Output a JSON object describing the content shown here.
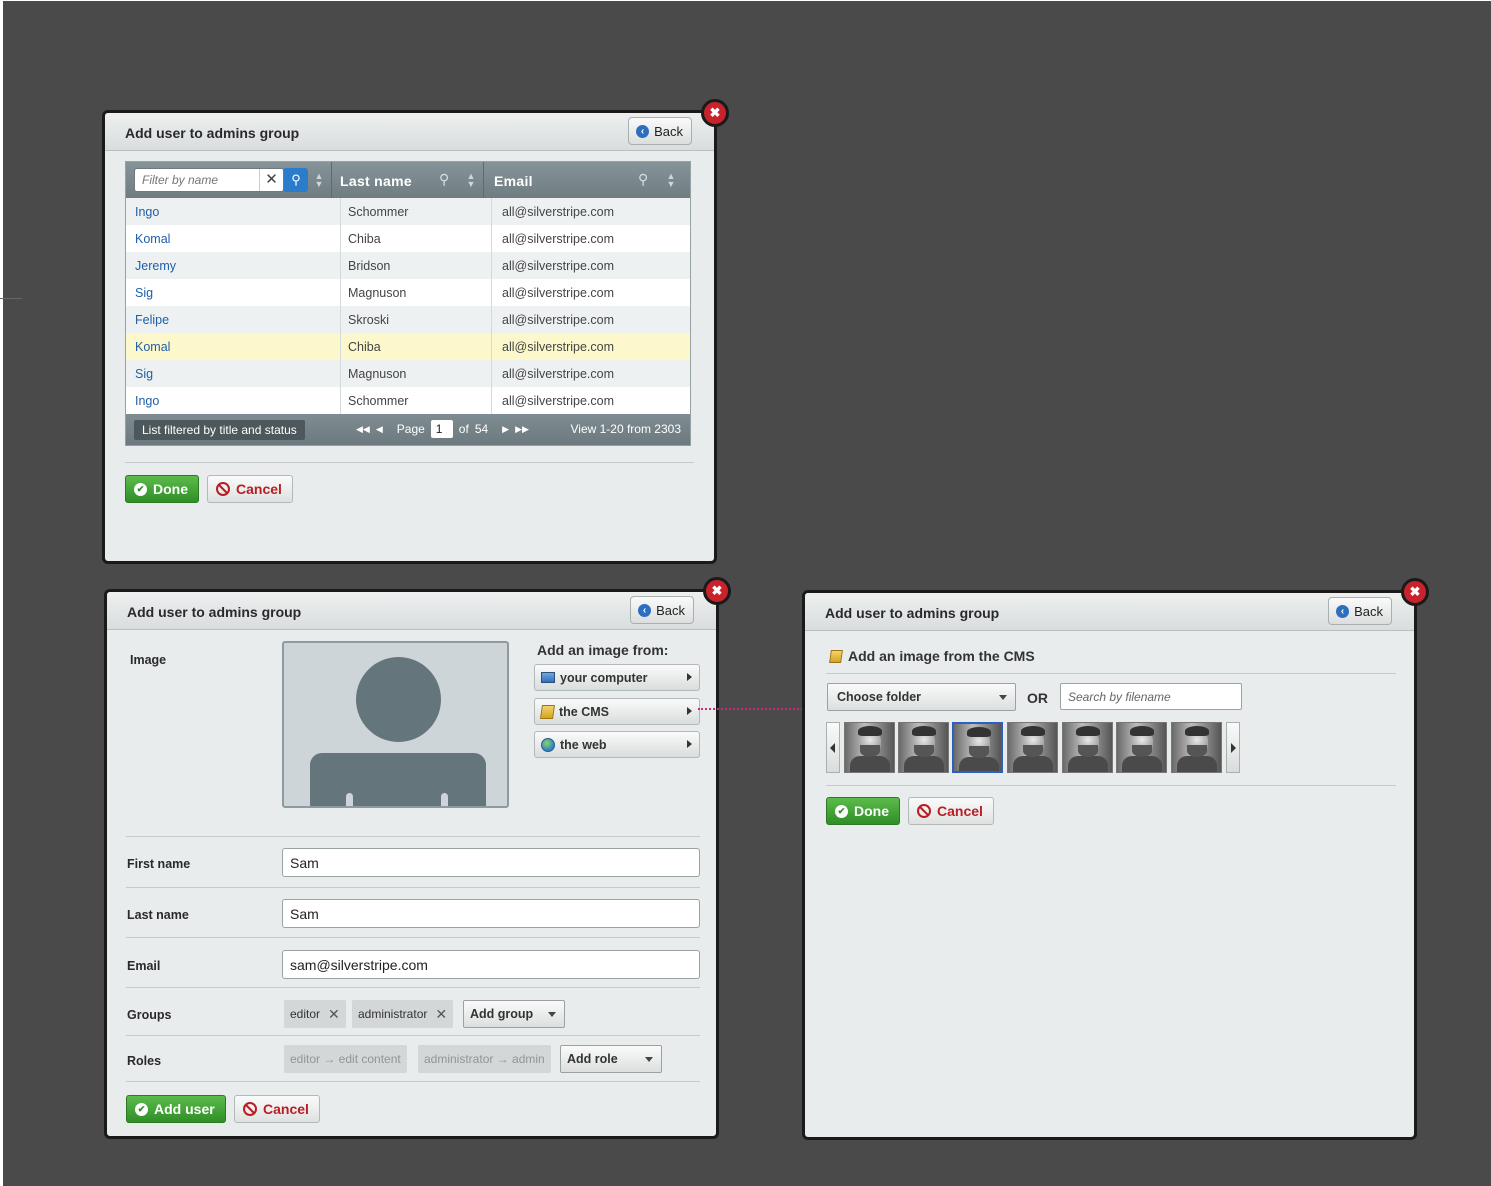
{
  "dialog1": {
    "title": "Add user to admins group",
    "back_label": "Back",
    "close_label": "✖",
    "filter_placeholder": "Filter by name",
    "columns": [
      "Last name",
      "Email"
    ],
    "rows": [
      {
        "first": "Ingo",
        "last": "Schommer",
        "email": "all@silverstripe.com"
      },
      {
        "first": "Komal",
        "last": "Chiba",
        "email": "all@silverstripe.com"
      },
      {
        "first": "Jeremy",
        "last": "Bridson",
        "email": "all@silverstripe.com"
      },
      {
        "first": "Sig",
        "last": "Magnuson",
        "email": "all@silverstripe.com"
      },
      {
        "first": "Felipe",
        "last": "Skroski",
        "email": "all@silverstripe.com"
      },
      {
        "first": "Komal",
        "last": "Chiba",
        "email": "all@silverstripe.com"
      },
      {
        "first": "Sig",
        "last": "Magnuson",
        "email": "all@silverstripe.com"
      },
      {
        "first": "Ingo",
        "last": "Schommer",
        "email": "all@silverstripe.com"
      }
    ],
    "footer": {
      "note": "List filtered by title and status",
      "page_label": "Page",
      "page_value": "1",
      "of_label": "of",
      "total_pages": "54",
      "view_info": "View 1-20 from 2303"
    },
    "done_label": "Done",
    "cancel_label": "Cancel"
  },
  "dialog2": {
    "title": "Add user to admins group",
    "back_label": "Back",
    "close_label": "✖",
    "image_label": "Image",
    "add_from_label": "Add an image from:",
    "sources": [
      "your computer",
      "the CMS",
      "the web"
    ],
    "first_name_label": "First name",
    "first_name_value": "Sam",
    "last_name_label": "Last name",
    "last_name_value": "Sam",
    "email_label": "Email",
    "email_value": "sam@silverstripe.com",
    "groups_label": "Groups",
    "groups": [
      "editor",
      "administrator"
    ],
    "add_group_label": "Add group",
    "roles_label": "Roles",
    "roles": [
      "editor → edit content",
      "administrator → admin"
    ],
    "add_role_label": "Add role",
    "add_user_label": "Add user",
    "cancel_label": "Cancel"
  },
  "dialog3": {
    "title": "Add user to admins group",
    "back_label": "Back",
    "close_label": "✖",
    "heading": "Add an image from the CMS",
    "folder_select": "Choose folder",
    "or_label": "OR",
    "search_placeholder": "Search by filename",
    "thumbnail_count": 7,
    "selected_thumbnail": 3,
    "done_label": "Done",
    "cancel_label": "Cancel"
  },
  "colors": {
    "background": "#4a4a4a",
    "link": "#1e5fa8",
    "green": "#3a9a2f",
    "danger": "#b81e24",
    "connector": "#d0267a",
    "highlight_row": "#fcf8cc"
  }
}
